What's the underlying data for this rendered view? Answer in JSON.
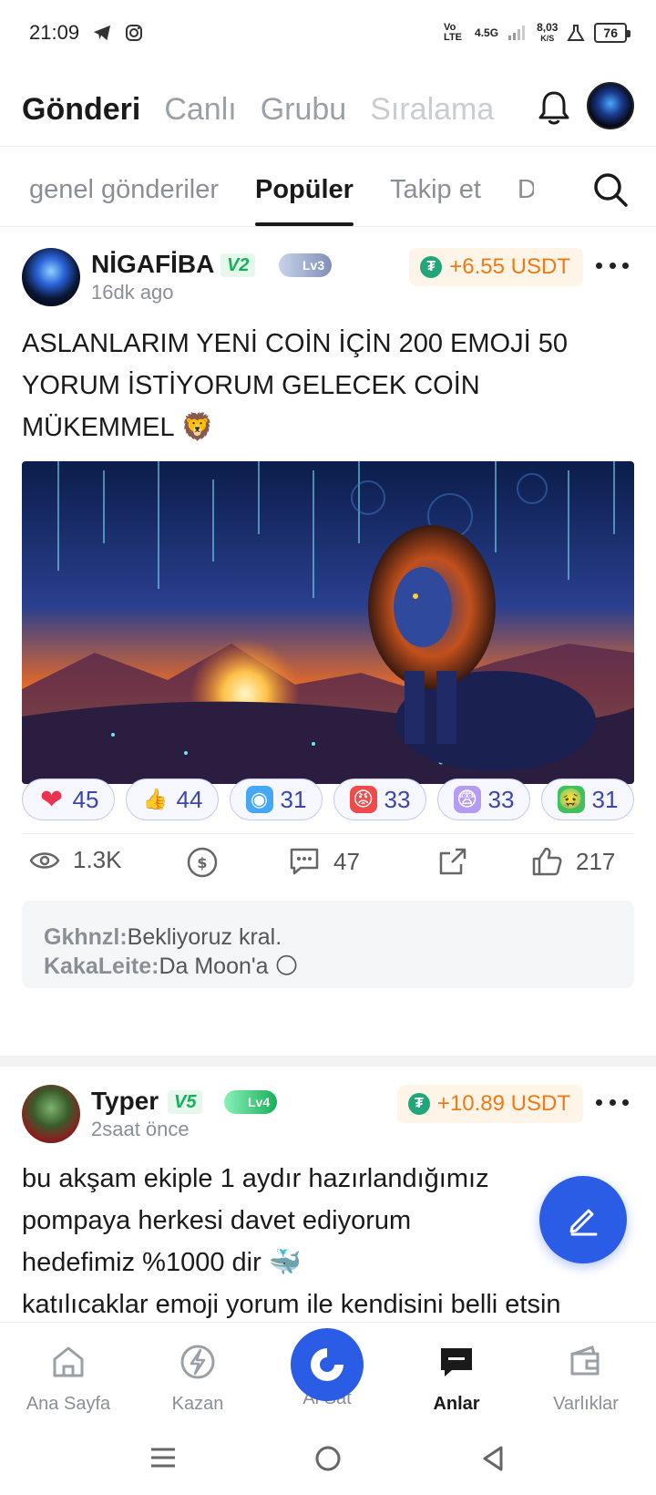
{
  "status": {
    "time": "21:09",
    "network": "4.5G",
    "speed": "8,03",
    "speed_unit": "K/S",
    "lte": "Vo LTE",
    "battery": "76"
  },
  "top_nav": {
    "tabs": [
      "Gönderi",
      "Canlı",
      "Grubu",
      "Sıralama"
    ]
  },
  "sub_nav": {
    "tabs": [
      "genel gönderiler",
      "Popüler",
      "Takip et",
      "D"
    ]
  },
  "posts": [
    {
      "author": "NİGAFİBA",
      "vip": "V2",
      "level": "Lv3",
      "time": "16dk ago",
      "reward": "+6.55 USDT",
      "text": "ASLANLARIM YENİ COİN İÇİN 200 EMOJİ 50 YORUM İSTİYORUM GELECEK COİN MÜKEMMEL 🦁",
      "reactions": [
        {
          "emoji": "❤",
          "count": "45",
          "bg": "#ffffff",
          "color": "#e8344f"
        },
        {
          "emoji": "👍",
          "count": "44",
          "bg": "#ffffff",
          "color": "#f6b400"
        },
        {
          "emoji": "◉",
          "count": "31",
          "bg": "#45a8f5",
          "color": "#ffffff"
        },
        {
          "emoji": "😡",
          "count": "33",
          "bg": "#f04a4a",
          "color": "#ffffff"
        },
        {
          "emoji": "😨",
          "count": "33",
          "bg": "#b49cf2",
          "color": "#ffffff"
        },
        {
          "emoji": "🤢",
          "count": "31",
          "bg": "#3fc25e",
          "color": "#ffffff"
        }
      ],
      "stats": {
        "views": "1.3K",
        "comments": "47",
        "likes": "217"
      },
      "comments": [
        {
          "user": "Gkhnzl:",
          "text": "Bekliyoruz kral."
        },
        {
          "user": "KakaLeite:",
          "text": "Da Moon'a 🌕"
        }
      ]
    },
    {
      "author": "Typer",
      "vip": "V5",
      "level": "Lv4",
      "time": "2saat önce",
      "reward": "+10.89 USDT",
      "text_lines": [
        "bu akşam ekiple 1 aydır hazırlandığımız",
        "pompaya herkesi davet ediyorum",
        "hedefimiz %1000 dir 🐳",
        "katılıcaklar emoji yorum ile kendisini belli etsin"
      ]
    }
  ],
  "bottom_nav": {
    "items": [
      "Ana Sayfa",
      "Kazan",
      "Al Sat",
      "Anlar",
      "Varlıklar"
    ]
  },
  "colors": {
    "accent": "#2b5ce6",
    "reward": "#f07a13",
    "vip": "#17b05a"
  }
}
